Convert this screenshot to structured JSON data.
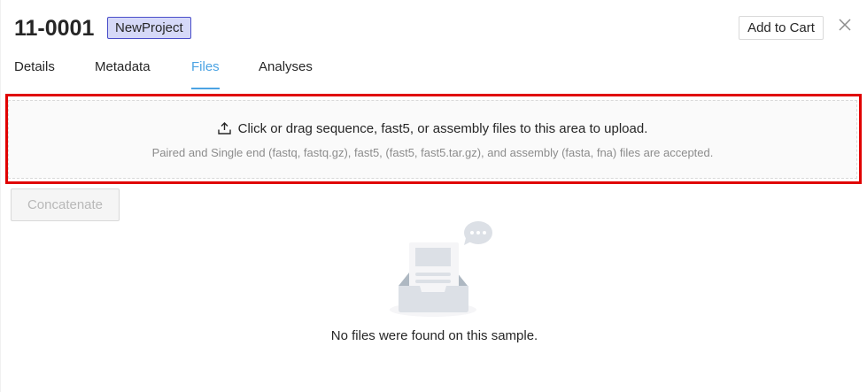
{
  "header": {
    "sample_id": "11-0001",
    "project_tag": "NewProject",
    "add_to_cart_label": "Add to Cart"
  },
  "tabs": [
    {
      "label": "Details",
      "active": false
    },
    {
      "label": "Metadata",
      "active": false
    },
    {
      "label": "Files",
      "active": true
    },
    {
      "label": "Analyses",
      "active": false
    }
  ],
  "upload": {
    "main_text": "Click or drag sequence, fast5, or assembly files to this area to upload.",
    "hint_text": "Paired and Single end (fastq, fastq.gz), fast5, (fast5, fast5.tar.gz), and assembly (fasta, fna) files are accepted."
  },
  "toolbar": {
    "concatenate_label": "Concatenate"
  },
  "empty_state": {
    "message": "No files were found on this sample."
  },
  "colors": {
    "accent": "#4ba3e3",
    "tag_bg": "#d6d9f8",
    "tag_border": "#4a4ec9",
    "highlight": "#e00000"
  }
}
